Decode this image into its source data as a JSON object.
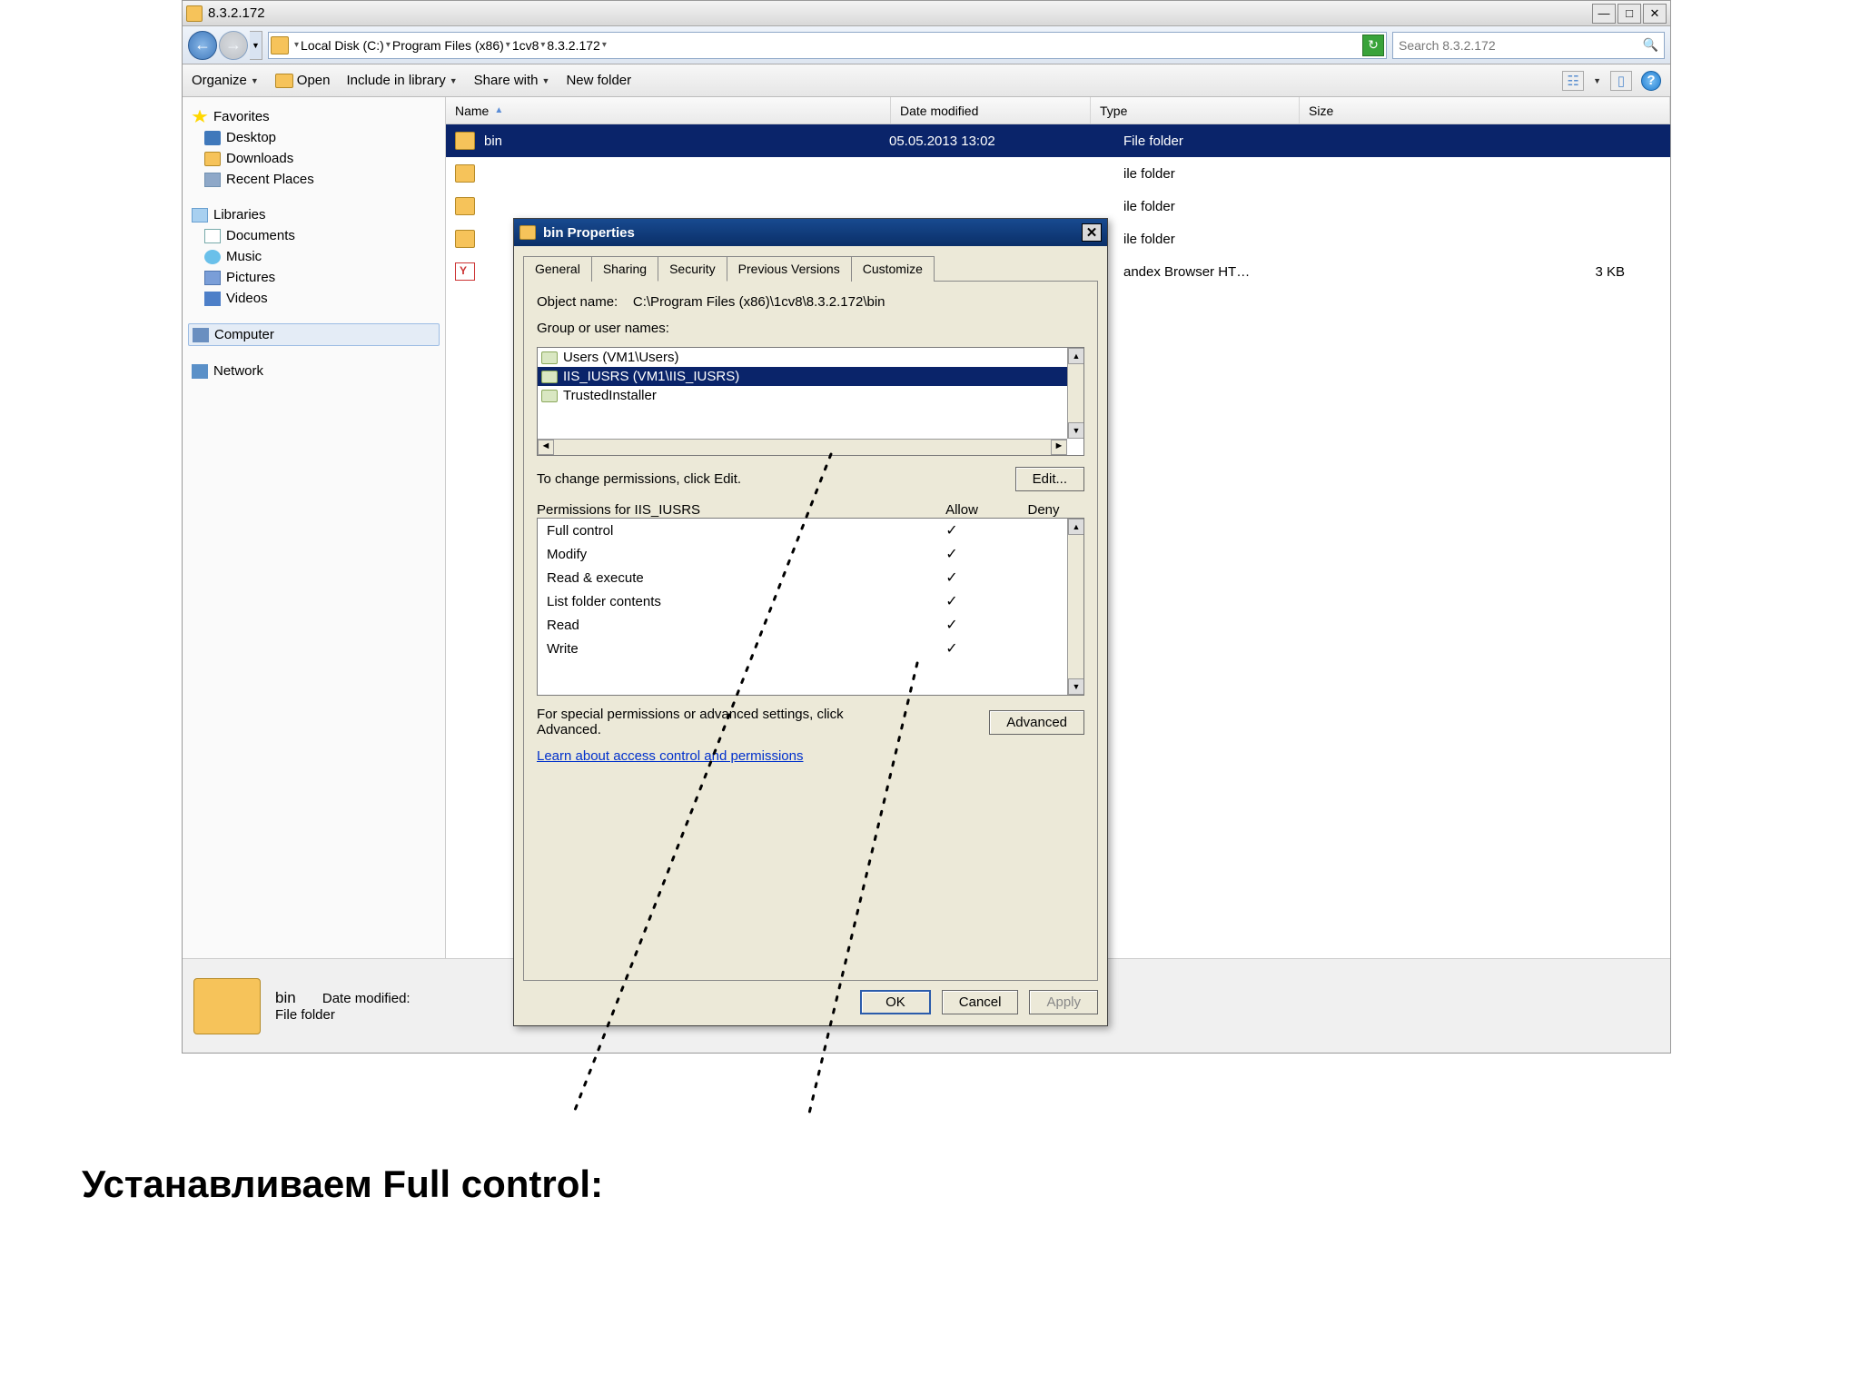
{
  "window": {
    "title": "8.3.2.172",
    "search_placeholder": "Search 8.3.2.172"
  },
  "breadcrumbs": [
    "Local Disk (C:)",
    "Program Files (x86)",
    "1cv8",
    "8.3.2.172"
  ],
  "toolbar": {
    "organize": "Organize",
    "open": "Open",
    "include": "Include in library",
    "share": "Share with",
    "newfolder": "New folder"
  },
  "sidebar": {
    "favorites": "Favorites",
    "desktop": "Desktop",
    "downloads": "Downloads",
    "recent": "Recent Places",
    "libraries": "Libraries",
    "documents": "Documents",
    "music": "Music",
    "pictures": "Pictures",
    "videos": "Videos",
    "computer": "Computer",
    "network": "Network"
  },
  "columns": {
    "name": "Name",
    "date": "Date modified",
    "type": "Type",
    "size": "Size"
  },
  "rows": [
    {
      "name": "bin",
      "date": "05.05.2013 13:02",
      "type": "File folder",
      "size": ""
    },
    {
      "name": "",
      "date": "",
      "type": "ile folder",
      "size": ""
    },
    {
      "name": "",
      "date": "",
      "type": "ile folder",
      "size": ""
    },
    {
      "name": "",
      "date": "",
      "type": "ile folder",
      "size": ""
    },
    {
      "name": "",
      "date": "",
      "type": "andex Browser HT…",
      "size": "3 KB"
    }
  ],
  "details": {
    "name": "bin",
    "type": "File folder",
    "date_label": "Date modified:"
  },
  "properties": {
    "title": "bin Properties",
    "tabs": [
      "General",
      "Sharing",
      "Security",
      "Previous Versions",
      "Customize"
    ],
    "active_tab": 2,
    "object_label": "Object name:",
    "object_path": "C:\\Program Files (x86)\\1cv8\\8.3.2.172\\bin",
    "group_label": "Group or user names:",
    "groups": [
      {
        "label": "Users (VM1\\Users)",
        "selected": false
      },
      {
        "label": "IIS_IUSRS (VM1\\IIS_IUSRS)",
        "selected": true
      },
      {
        "label": "TrustedInstaller",
        "selected": false
      }
    ],
    "edit_hint": "To change permissions, click Edit.",
    "edit_btn": "Edit...",
    "perm_label": "Permissions for IIS_IUSRS",
    "perm_allow": "Allow",
    "perm_deny": "Deny",
    "perms": [
      {
        "name": "Full control",
        "allow": true,
        "deny": false
      },
      {
        "name": "Modify",
        "allow": true,
        "deny": false
      },
      {
        "name": "Read & execute",
        "allow": true,
        "deny": false
      },
      {
        "name": "List folder contents",
        "allow": true,
        "deny": false
      },
      {
        "name": "Read",
        "allow": true,
        "deny": false
      },
      {
        "name": "Write",
        "allow": true,
        "deny": false
      }
    ],
    "adv_hint": "For special permissions or advanced settings, click Advanced.",
    "adv_btn": "Advanced",
    "learn_link": "Learn about access control and permissions",
    "ok": "OK",
    "cancel": "Cancel",
    "apply": "Apply"
  },
  "caption": "Устанавливаем Full control:"
}
